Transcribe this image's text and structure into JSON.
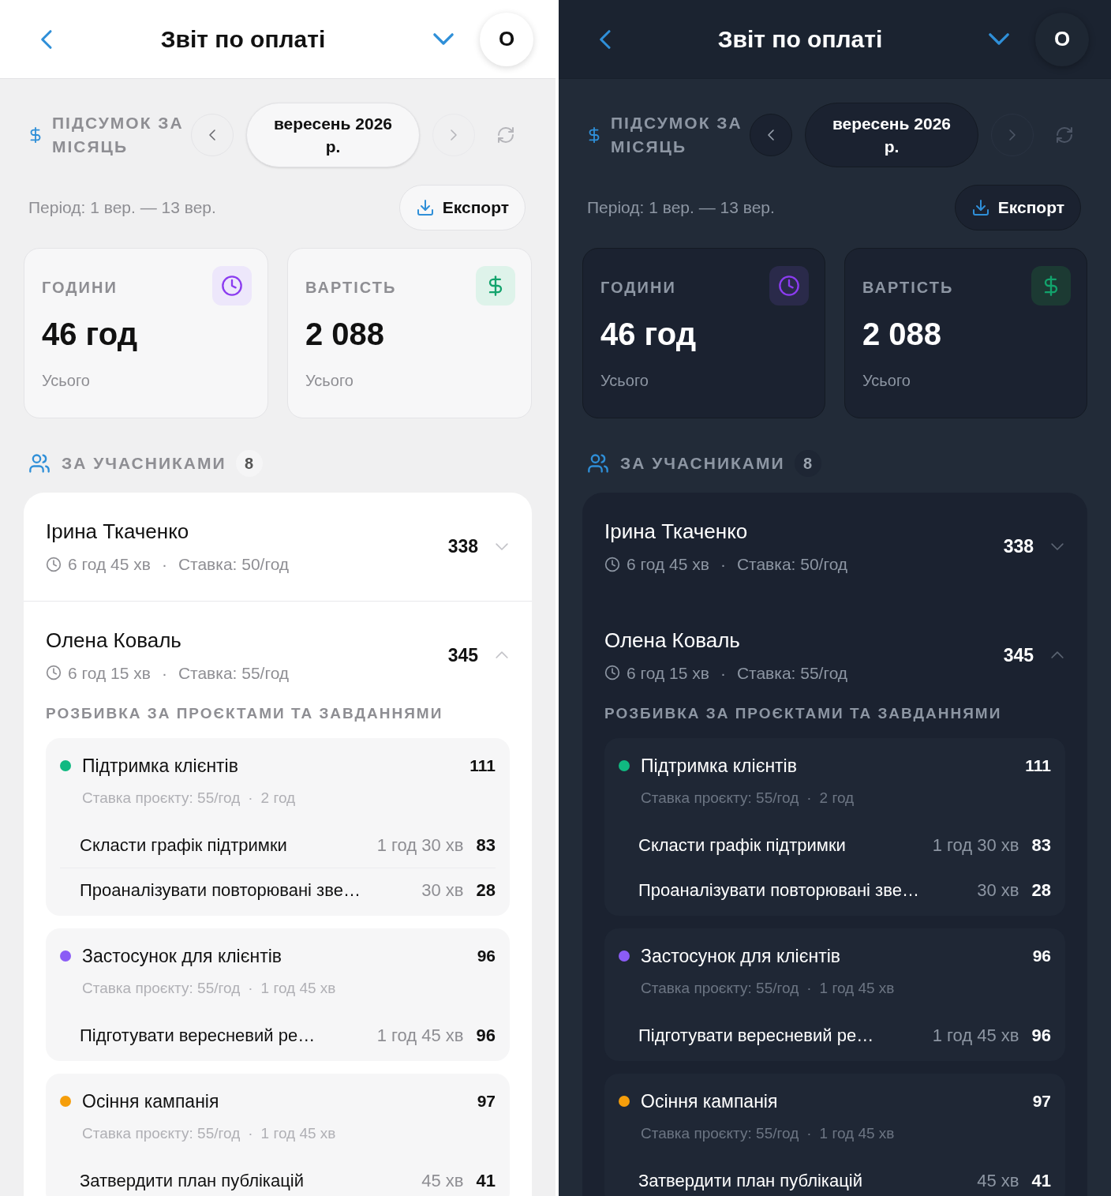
{
  "panels": [
    {
      "kind": "light",
      "header": {
        "title": "Звіт по оплаті",
        "avatar": "О"
      },
      "summary": {
        "label": "ПІДСУМОК ЗА МІСЯЦЬ",
        "month": "вересень 2026 р.",
        "period": "Період: 1 вер. — 13 вер.",
        "export": "Експорт"
      },
      "stats": [
        {
          "kind": "hours",
          "label": "ГОДИНИ",
          "value": "46 год",
          "caption": "Усього"
        },
        {
          "kind": "cost",
          "label": "ВАРТІСТЬ",
          "value": "2 088",
          "caption": "Усього"
        }
      ],
      "members_section": {
        "title": "ЗА УЧАСНИКАМИ",
        "count": "8"
      },
      "members": [
        {
          "name": "Ірина Ткаченко",
          "time": "6 год 45 хв",
          "separator": "·",
          "rate": "Ставка: 50/год",
          "amount": "338",
          "expanded": false
        },
        {
          "name": "Олена Коваль",
          "time": "6 год 15 хв",
          "separator": "·",
          "rate": "Ставка: 55/год",
          "amount": "345",
          "expanded": true,
          "breakdown_title": "РОЗБИВКА ЗА ПРОЄКТАМИ ТА ЗАВДАННЯМИ",
          "projects": [
            {
              "name": "Підтримка клієнтів",
              "color": "#10b981",
              "amount": "111",
              "rate": "Ставка проєкту: 55/год",
              "separator": "·",
              "time": "2 год",
              "tasks": [
                {
                  "name": "Скласти графік підтримки",
                  "time": "1 год 30 хв",
                  "amount": "83"
                },
                {
                  "name": "Проаналізувати повторювані зве…",
                  "time": "30 хв",
                  "amount": "28"
                }
              ]
            },
            {
              "name": "Застосунок для клієнтів",
              "color": "#8b5cf6",
              "amount": "96",
              "rate": "Ставка проєкту: 55/год",
              "separator": "·",
              "time": "1 год 45 хв",
              "tasks": [
                {
                  "name": "Підготувати вересневий ре…",
                  "time": "1 год 45 хв",
                  "amount": "96"
                }
              ]
            },
            {
              "name": "Осіння кампанія",
              "color": "#f59e0b",
              "amount": "97",
              "rate": "Ставка проєкту: 55/год",
              "separator": "·",
              "time": "1 год 45 хв",
              "tasks": [
                {
                  "name": "Затвердити план публікацій",
                  "time": "45 хв",
                  "amount": "41"
                }
              ]
            }
          ]
        }
      ]
    },
    {
      "kind": "dark",
      "header": {
        "title": "Звіт по оплаті",
        "avatar": "О"
      },
      "summary": {
        "label": "ПІДСУМОК ЗА МІСЯЦЬ",
        "month": "вересень 2026 р.",
        "period": "Період: 1 вер. — 13 вер.",
        "export": "Експорт"
      },
      "stats": [
        {
          "kind": "hours",
          "label": "ГОДИНИ",
          "value": "46 год",
          "caption": "Усього"
        },
        {
          "kind": "cost",
          "label": "ВАРТІСТЬ",
          "value": "2 088",
          "caption": "Усього"
        }
      ],
      "members_section": {
        "title": "ЗА УЧАСНИКАМИ",
        "count": "8"
      },
      "members": [
        {
          "name": "Ірина Ткаченко",
          "time": "6 год 45 хв",
          "separator": "·",
          "rate": "Ставка: 50/год",
          "amount": "338",
          "expanded": false
        },
        {
          "name": "Олена Коваль",
          "time": "6 год 15 хв",
          "separator": "·",
          "rate": "Ставка: 55/год",
          "amount": "345",
          "expanded": true,
          "breakdown_title": "РОЗБИВКА ЗА ПРОЄКТАМИ ТА ЗАВДАННЯМИ",
          "projects": [
            {
              "name": "Підтримка клієнтів",
              "color": "#10b981",
              "amount": "111",
              "rate": "Ставка проєкту: 55/год",
              "separator": "·",
              "time": "2 год",
              "tasks": [
                {
                  "name": "Скласти графік підтримки",
                  "time": "1 год 30 хв",
                  "amount": "83"
                },
                {
                  "name": "Проаналізувати повторювані зве…",
                  "time": "30 хв",
                  "amount": "28"
                }
              ]
            },
            {
              "name": "Застосунок для клієнтів",
              "color": "#8b5cf6",
              "amount": "96",
              "rate": "Ставка проєкту: 55/год",
              "separator": "·",
              "time": "1 год 45 хв",
              "tasks": [
                {
                  "name": "Підготувати вересневий ре…",
                  "time": "1 год 45 хв",
                  "amount": "96"
                }
              ]
            },
            {
              "name": "Осіння кампанія",
              "color": "#f59e0b",
              "amount": "97",
              "rate": "Ставка проєкту: 55/год",
              "separator": "·",
              "time": "1 год 45 хв",
              "tasks": [
                {
                  "name": "Затвердити план публікацій",
                  "time": "45 хв",
                  "amount": "41"
                }
              ]
            }
          ]
        }
      ]
    }
  ]
}
